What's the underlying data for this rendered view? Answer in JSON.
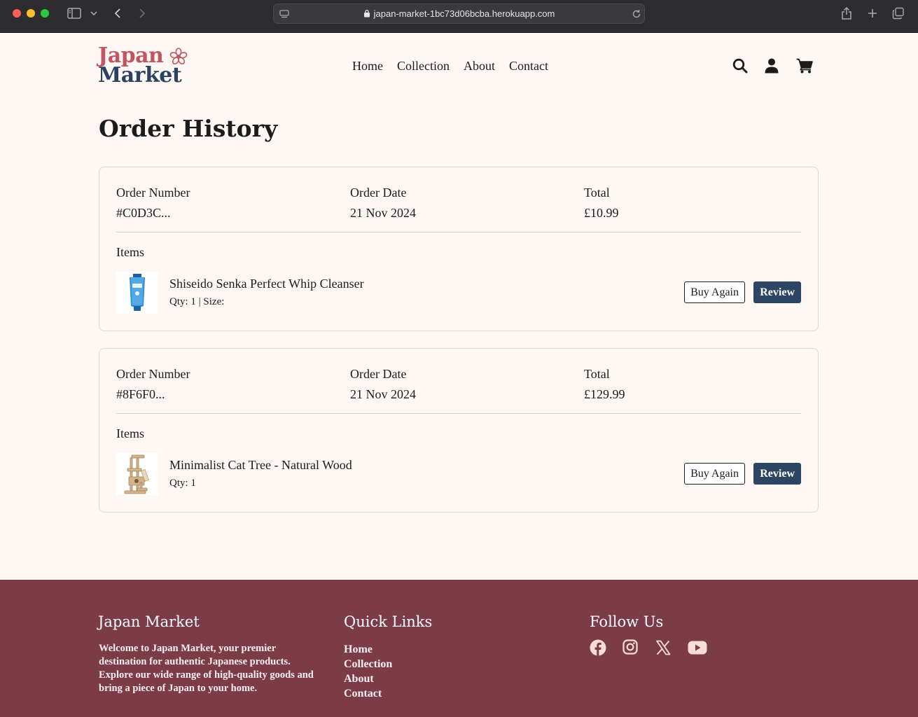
{
  "browser": {
    "url": "japan-market-1bc73d06bcba.herokuapp.com"
  },
  "header": {
    "logo_line1": "Japan",
    "logo_line2": "Market",
    "nav": [
      "Home",
      "Collection",
      "About",
      "Contact"
    ],
    "icons": [
      "search-icon",
      "user-icon",
      "cart-icon"
    ]
  },
  "main": {
    "title": "Order History",
    "orders": [
      {
        "number_label": "Order Number",
        "number": "#C0D3C...",
        "date_label": "Order Date",
        "date": "21 Nov 2024",
        "total_label": "Total",
        "total": "£10.99",
        "items_label": "Items",
        "item_name": "Shiseido Senka Perfect Whip Cleanser",
        "item_meta": "Qty: 1 | Size:",
        "buy_again": "Buy Again",
        "review": "Review"
      },
      {
        "number_label": "Order Number",
        "number": "#8F6F0...",
        "date_label": "Order Date",
        "date": "21 Nov 2024",
        "total_label": "Total",
        "total": "£129.99",
        "items_label": "Items",
        "item_name": "Minimalist Cat Tree - Natural Wood",
        "item_meta": "Qty: 1",
        "buy_again": "Buy Again",
        "review": "Review"
      }
    ]
  },
  "footer": {
    "brand_heading": "Japan Market",
    "brand_text": "Welcome to Japan Market, your premier destination for authentic Japanese products. Explore our wide range of high-quality goods and bring a piece of Japan to your home.",
    "links_heading": "Quick Links",
    "links": [
      "Home",
      "Collection",
      "About",
      "Contact"
    ],
    "follow_heading": "Follow Us",
    "social_icons": [
      "facebook-icon",
      "instagram-icon",
      "x-icon",
      "youtube-icon"
    ]
  },
  "colors": {
    "accent_navy": "#2c4563",
    "logo_red": "#c2555f",
    "footer_bg": "#7b3c48",
    "page_bg": "#fdf8f4"
  }
}
